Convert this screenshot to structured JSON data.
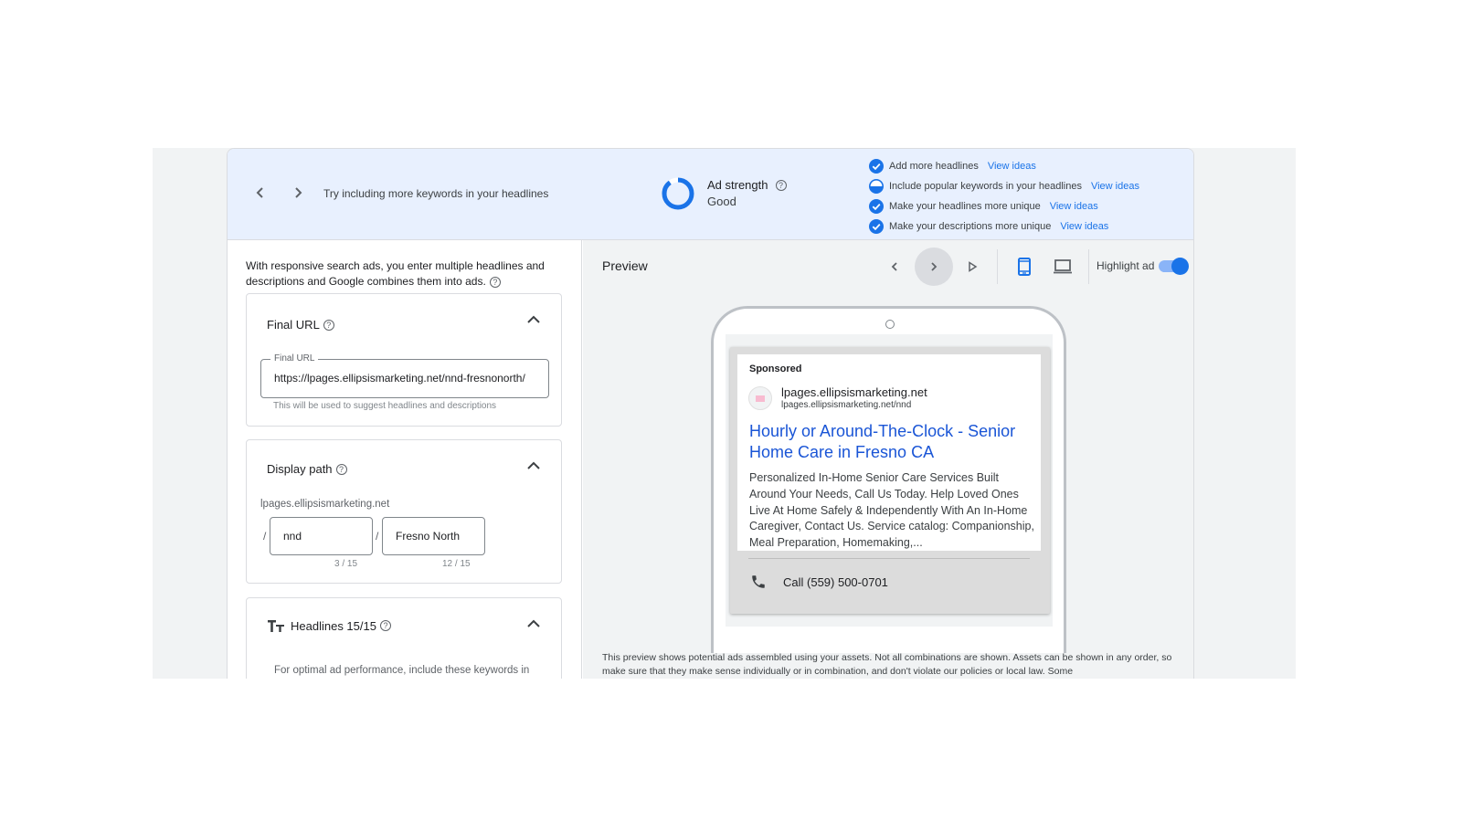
{
  "banner": {
    "tip": "Try including more keywords in your headlines",
    "ad_strength": {
      "title": "Ad strength",
      "value": "Good",
      "progress": 0.9
    },
    "suggestions": [
      {
        "text": "Add more headlines",
        "status": "done",
        "link": "View ideas"
      },
      {
        "text": "Include popular keywords in your headlines",
        "status": "partial",
        "link": "View ideas"
      },
      {
        "text": "Make your headlines more unique",
        "status": "done",
        "link": "View ideas"
      },
      {
        "text": "Make your descriptions more unique",
        "status": "done",
        "link": "View ideas"
      }
    ]
  },
  "left": {
    "intro": "With responsive search ads, you enter multiple headlines and descriptions and Google combines them into ads.",
    "final_url": {
      "title": "Final URL",
      "field_label": "Final URL",
      "value": "https://lpages.ellipsismarketing.net/nnd-fresnonorth/",
      "hint": "This will be used to suggest headlines and descriptions"
    },
    "display_path": {
      "title": "Display path",
      "domain": "lpages.ellipsismarketing.net",
      "path1": "nnd",
      "path1_count": "3 / 15",
      "path2": "Fresno North",
      "path2_count": "12 / 15",
      "separator": "/"
    },
    "headlines": {
      "title": "Headlines 15/15",
      "hint": "For optimal ad performance, include these keywords in"
    }
  },
  "preview": {
    "title": "Preview",
    "highlight_label": "Highlight ad",
    "highlight_on": true,
    "device": "mobile",
    "ad": {
      "sponsored": "Sponsored",
      "site_name": "lpages.ellipsismarketing.net",
      "site_url": "lpages.ellipsismarketing.net/nnd",
      "headline": "Hourly or Around-The-Clock - Senior Home Care in Fresno CA",
      "description": "Personalized In-Home Senior Care Services Built Around Your Needs, Call Us Today. Help Loved Ones Live At Home Safely & Independently With An In-Home Caregiver, Contact Us. Service catalog: Companionship, Meal Preparation, Homemaking,...",
      "call": "Call (559) 500-0701"
    },
    "disclaimer": "This preview shows potential ads assembled using your assets. Not all combinations are shown. Assets can be shown in any order, so make sure that they make sense individually or in combination, and don't violate our policies or local law. Some"
  },
  "colors": {
    "accent": "#1a73e8",
    "banner_bg": "#e8f0fe",
    "headline_link": "#1a55d6"
  }
}
